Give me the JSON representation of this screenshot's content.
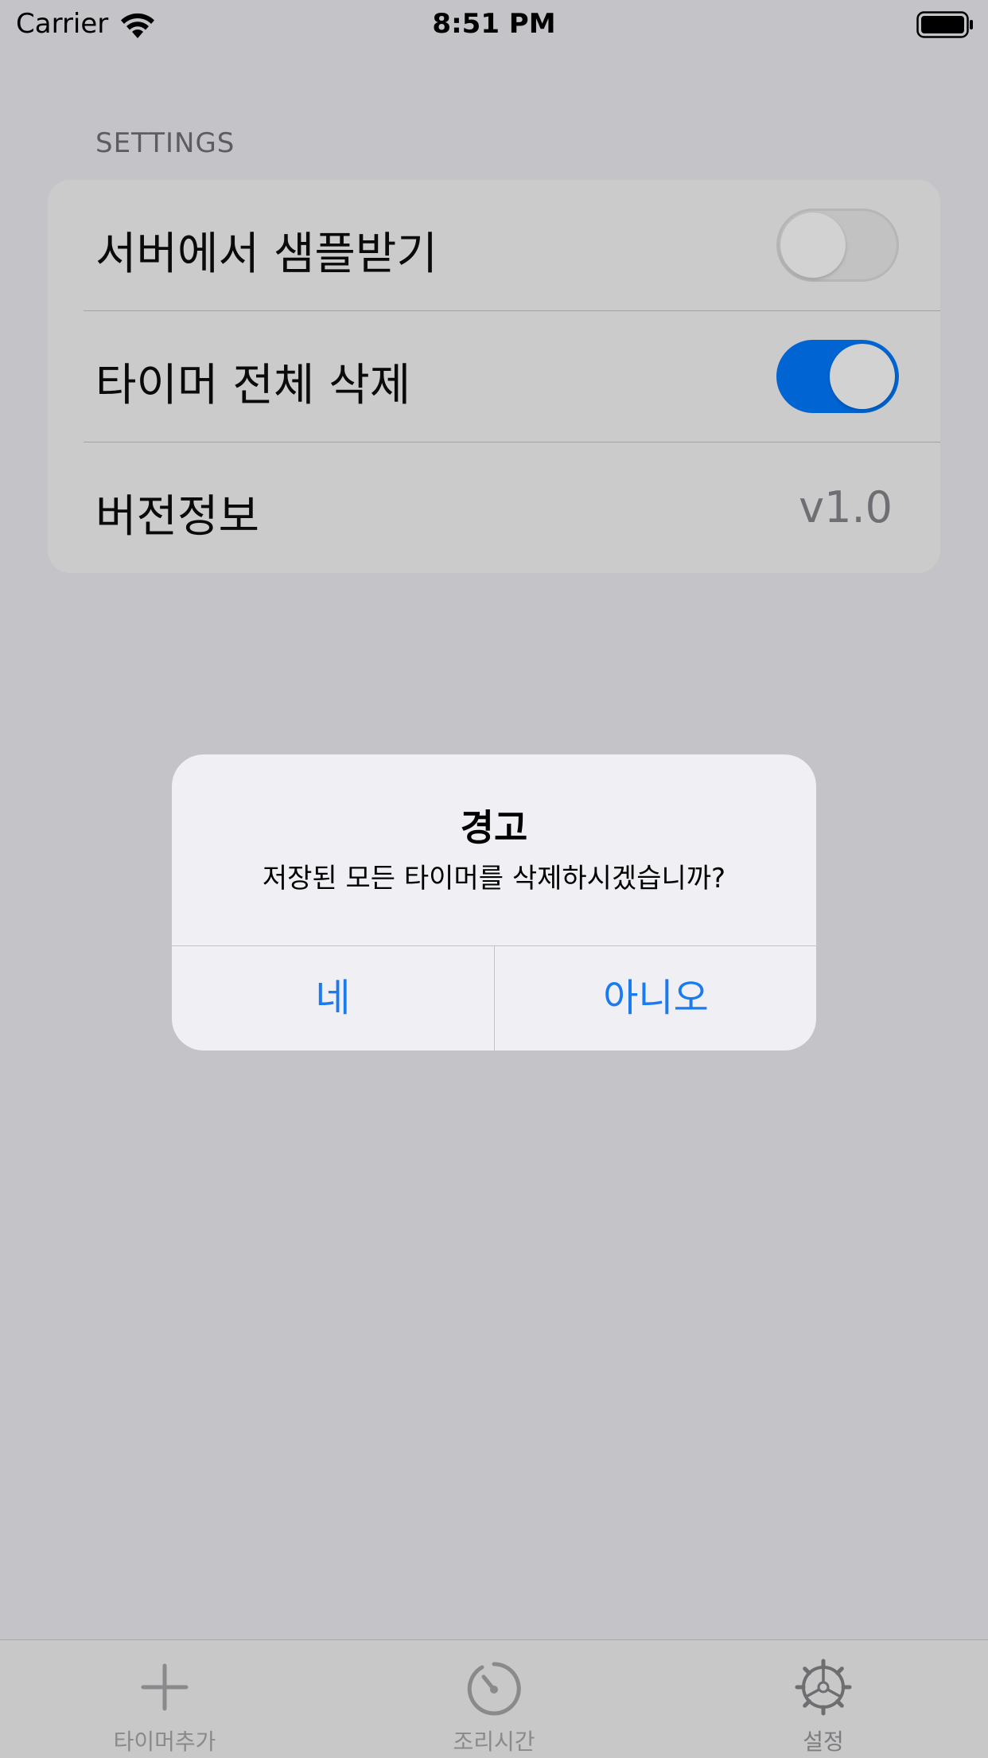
{
  "status_bar": {
    "carrier": "Carrier",
    "time": "8:51 PM",
    "icons": [
      "wifi-icon",
      "battery-icon"
    ]
  },
  "settings": {
    "section_header": "SETTINGS",
    "rows": [
      {
        "label": "서버에서 샘플받기",
        "control": "toggle",
        "on": false
      },
      {
        "label": "타이머 전체 삭제",
        "control": "toggle",
        "on": true
      },
      {
        "label": "버전정보",
        "value": "v1.0"
      }
    ]
  },
  "alert": {
    "title": "경고",
    "message": "저장된 모든 타이머를 삭제하시겠습니까?",
    "buttons": [
      "네",
      "아니오"
    ]
  },
  "tab_bar": {
    "tabs": [
      {
        "label": "타이머추가",
        "icon": "plus-icon"
      },
      {
        "label": "조리시간",
        "icon": "timer-icon"
      },
      {
        "label": "설정",
        "icon": "gear-icon",
        "selected": true
      }
    ]
  },
  "colors": {
    "accent": "#1a7bf0",
    "toggle_on": "#0064d2",
    "dimmed_background": "#c4c3c8"
  }
}
